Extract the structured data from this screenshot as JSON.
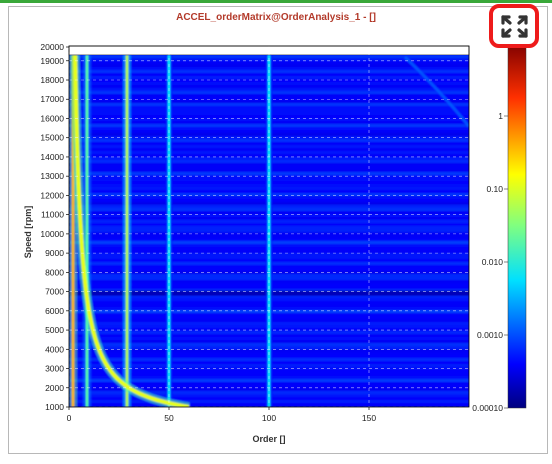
{
  "panel": {
    "title": "ACCEL_orderMatrix@OrderAnalysis_1 - []",
    "accent_color": "#3aa83a",
    "title_color": "#b33a2a"
  },
  "toolbar": {
    "expand_icon": "expand-arrows-icon",
    "highlight_color": "#ee1b1b"
  },
  "chart_data": {
    "type": "heatmap",
    "title": "ACCEL_orderMatrix@OrderAnalysis_1 - []",
    "xlabel": "Order []",
    "ylabel": "Speed [rpm]",
    "xlim": [
      0,
      200
    ],
    "ylim": [
      1000,
      20000
    ],
    "x_ticks": [
      "0",
      "50",
      "100",
      "150"
    ],
    "x_tick_values": [
      0,
      50,
      100,
      150
    ],
    "y_ticks": [
      "1000",
      "2000",
      "3000",
      "4000",
      "5000",
      "6000",
      "7000",
      "8000",
      "9000",
      "10000",
      "11000",
      "12000",
      "13000",
      "14000",
      "15000",
      "16000",
      "17000",
      "18000",
      "19000",
      "20000"
    ],
    "y_tick_values": [
      1000,
      2000,
      3000,
      4000,
      5000,
      6000,
      7000,
      8000,
      9000,
      10000,
      11000,
      12000,
      13000,
      14000,
      15000,
      16000,
      17000,
      18000,
      19000,
      20000
    ],
    "grid": true,
    "colorbar": {
      "scale": "log",
      "min": 0.0001,
      "max": 10,
      "tick_labels": [
        "1",
        "0.10",
        "0.010",
        "0.0010",
        "0.00010"
      ],
      "tick_values": [
        1,
        0.1,
        0.01,
        0.001,
        0.0001
      ],
      "colormap": "jet"
    },
    "order_lines": [
      {
        "order": 2,
        "level": 0.3
      },
      {
        "order": 9,
        "level": 0.02
      },
      {
        "order": 29,
        "level": 0.06
      },
      {
        "order": 50,
        "level": 0.006
      },
      {
        "order": 100,
        "level": 0.006
      }
    ],
    "frequency_ridge": {
      "frequency_hz": 1000,
      "level": 0.1
    },
    "background_level": 0.0003
  }
}
